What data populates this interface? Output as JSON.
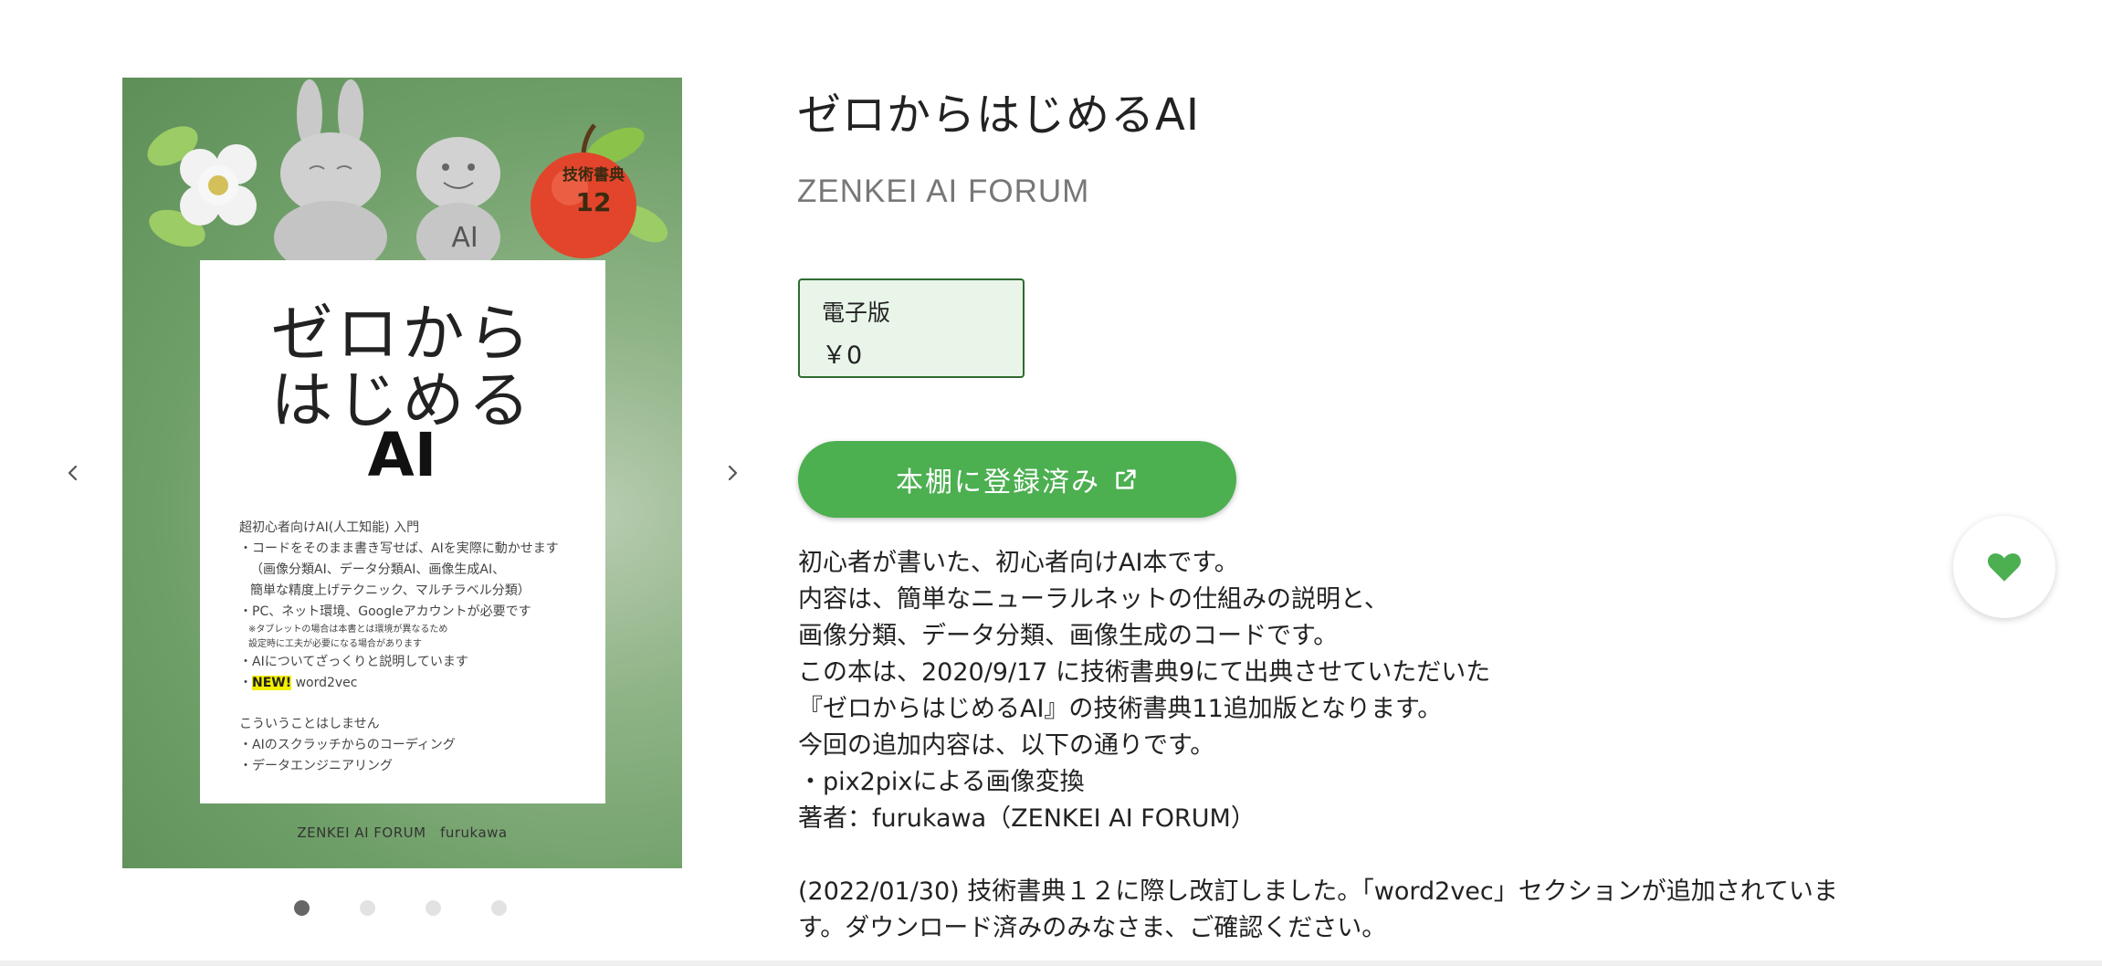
{
  "carousel": {
    "prev_icon": "chevron-left-icon",
    "next_icon": "chevron-right-icon",
    "slide_count": 4,
    "active_slide": 1,
    "cover": {
      "badge_line1": "技術書典",
      "badge_line2": "12",
      "ai_chip": "AI",
      "title_line1": "ゼロから",
      "title_line2": "はじめる",
      "title_line3": "AI",
      "notes": [
        "超初心者向けAI(人工知能) 入門",
        "・コードをそのまま書き写せば、AIを実際に動かせます",
        "（画像分類AI、データ分類AI、画像生成AI、",
        "簡単な精度上げテクニック、マルチラベル分類）",
        "・PC、ネット環境、Googleアカウントが必要です",
        "※タブレットの場合は本書とは環境が異なるため",
        "設定時に工夫が必要になる場合があります",
        "・AIについてざっくりと説明しています",
        "NEW!",
        "word2vec",
        "こういうことはしません",
        "・AIのスクラッチからのコーディング",
        "・データエンジニアリング"
      ],
      "author_line": "ZENKEI AI FORUM　furukawa"
    }
  },
  "book": {
    "title": "ゼロからはじめるAI",
    "circle": "ZENKEI AI FORUM",
    "edition_label": "電子版",
    "price": "￥0",
    "shelf_button_label": "本棚に登録済み",
    "shelf_button_icon": "external-link-icon",
    "favorite_icon": "heart-icon",
    "description": [
      "初心者が書いた、初心者向けAI本です。",
      "内容は、簡単なニューラルネットの仕組みの説明と、",
      "画像分類、データ分類、画像生成のコードです。",
      "この本は、2020/9/17 に技術書典9にて出典させていただいた",
      "『ゼロからはじめるAI』の技術書典11追加版となります。",
      "今回の追加内容は、以下の通りです。",
      "・pix2pixによる画像変換",
      "著者：furukawa（ZENKEI AI FORUM）",
      "(2022/01/30) 技術書典１２に際し改訂しました。「word2vec」セクションが追加されていま",
      "す。ダウンロード済みのみなさま、ご確認ください。"
    ]
  },
  "colors": {
    "accent_green": "#4caf50",
    "price_box_bg": "#eaf5ea",
    "price_box_border": "#2f6b31"
  }
}
